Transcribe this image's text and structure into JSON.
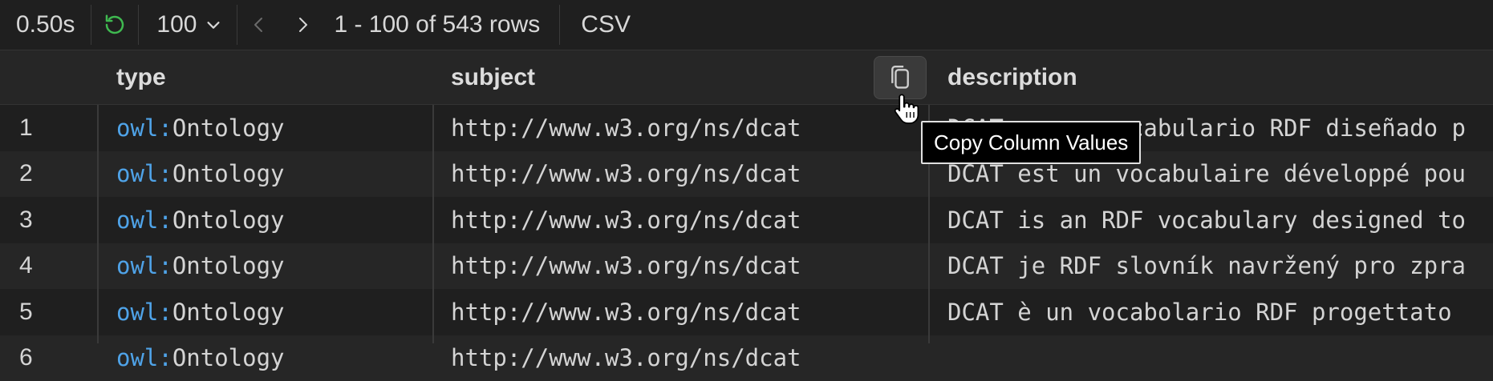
{
  "toolbar": {
    "timer": "0.50s",
    "page_size": "100",
    "row_count": "1 - 100 of 543 rows",
    "export_label": "CSV"
  },
  "colors": {
    "background": "#1f1f1f",
    "row_alt": "#262626",
    "accent_green": "#3fb950",
    "namespace_blue": "#4fa3e8"
  },
  "icons": [
    "refresh-icon",
    "chevron-down-icon",
    "chevron-left-icon",
    "chevron-right-icon",
    "copy-icon",
    "hand-cursor-icon"
  ],
  "columns": [
    "type",
    "subject",
    "description"
  ],
  "tooltip": "Copy Column Values",
  "rows": [
    {
      "index": "1",
      "type_prefix": "owl:",
      "type_local": "Ontology",
      "subject": "http://www.w3.org/ns/dcat",
      "description": "DCAT es un vocabulario RDF diseñado p"
    },
    {
      "index": "2",
      "type_prefix": "owl:",
      "type_local": "Ontology",
      "subject": "http://www.w3.org/ns/dcat",
      "description": "DCAT est un vocabulaire développé pou"
    },
    {
      "index": "3",
      "type_prefix": "owl:",
      "type_local": "Ontology",
      "subject": "http://www.w3.org/ns/dcat",
      "description": "DCAT is an RDF vocabulary designed to"
    },
    {
      "index": "4",
      "type_prefix": "owl:",
      "type_local": "Ontology",
      "subject": "http://www.w3.org/ns/dcat",
      "description": "DCAT je RDF slovník navržený pro zpra"
    },
    {
      "index": "5",
      "type_prefix": "owl:",
      "type_local": "Ontology",
      "subject": "http://www.w3.org/ns/dcat",
      "description": "DCAT è un vocabolario RDF progettato"
    },
    {
      "index": "6",
      "type_prefix": "owl:",
      "type_local": "Ontology",
      "subject": "http://www.w3.org/ns/dcat",
      "description": ""
    }
  ]
}
